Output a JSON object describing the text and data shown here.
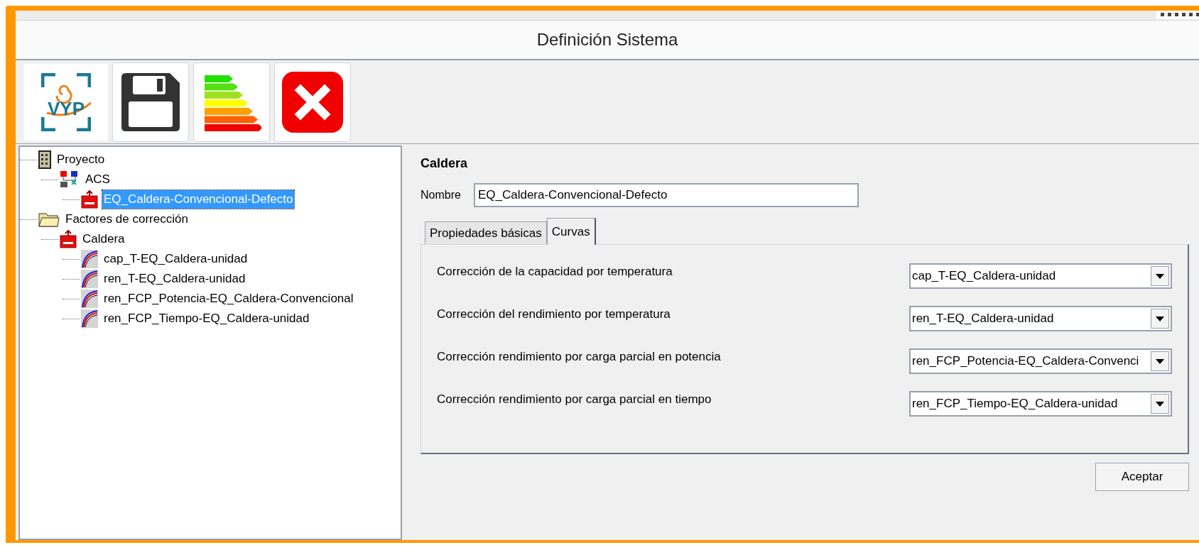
{
  "window": {
    "title": "Definición Sistema"
  },
  "toolbar": {
    "logo_text": "VYP",
    "buttons": [
      {
        "kind": "save"
      },
      {
        "kind": "energy"
      },
      {
        "kind": "close"
      }
    ]
  },
  "tree": [
    {
      "label": "Proyecto",
      "kind": "project",
      "selected": false,
      "children": [
        {
          "label": "ACS",
          "kind": "system",
          "selected": false,
          "children": [
            {
              "label": "EQ_Caldera-Convencional-Defecto",
              "kind": "boiler",
              "selected": true
            }
          ]
        }
      ]
    },
    {
      "label": "Factores de corrección",
      "kind": "folder",
      "selected": false,
      "children": [
        {
          "label": "Caldera",
          "kind": "boiler",
          "selected": false,
          "children": [
            {
              "label": "cap_T-EQ_Caldera-unidad",
              "kind": "curve",
              "selected": false
            },
            {
              "label": "ren_T-EQ_Caldera-unidad",
              "kind": "curve",
              "selected": false
            },
            {
              "label": "ren_FCP_Potencia-EQ_Caldera-Convencional",
              "kind": "curve",
              "selected": false
            },
            {
              "label": "ren_FCP_Tiempo-EQ_Caldera-unidad",
              "kind": "curve",
              "selected": false
            }
          ]
        }
      ]
    }
  ],
  "detail": {
    "heading": "Caldera",
    "name_label": "Nombre",
    "name_value": "EQ_Caldera-Convencional-Defecto",
    "tabs": [
      {
        "label": "Propiedades básicas",
        "selected": false
      },
      {
        "label": "Curvas",
        "selected": true
      }
    ],
    "curves": [
      {
        "label": "Corrección de la capacidad por temperatura",
        "value": "cap_T-EQ_Caldera-unidad"
      },
      {
        "label": "Corrección del rendimiento por temperatura",
        "value": "ren_T-EQ_Caldera-unidad"
      },
      {
        "label": "Corrección rendimiento por carga parcial en potencia",
        "value": "ren_FCP_Potencia-EQ_Caldera-Convenci"
      },
      {
        "label": "Corrección rendimiento por carga parcial en tiempo",
        "value": "ren_FCP_Tiempo-EQ_Caldera-unidad"
      }
    ],
    "accept": "Aceptar"
  }
}
